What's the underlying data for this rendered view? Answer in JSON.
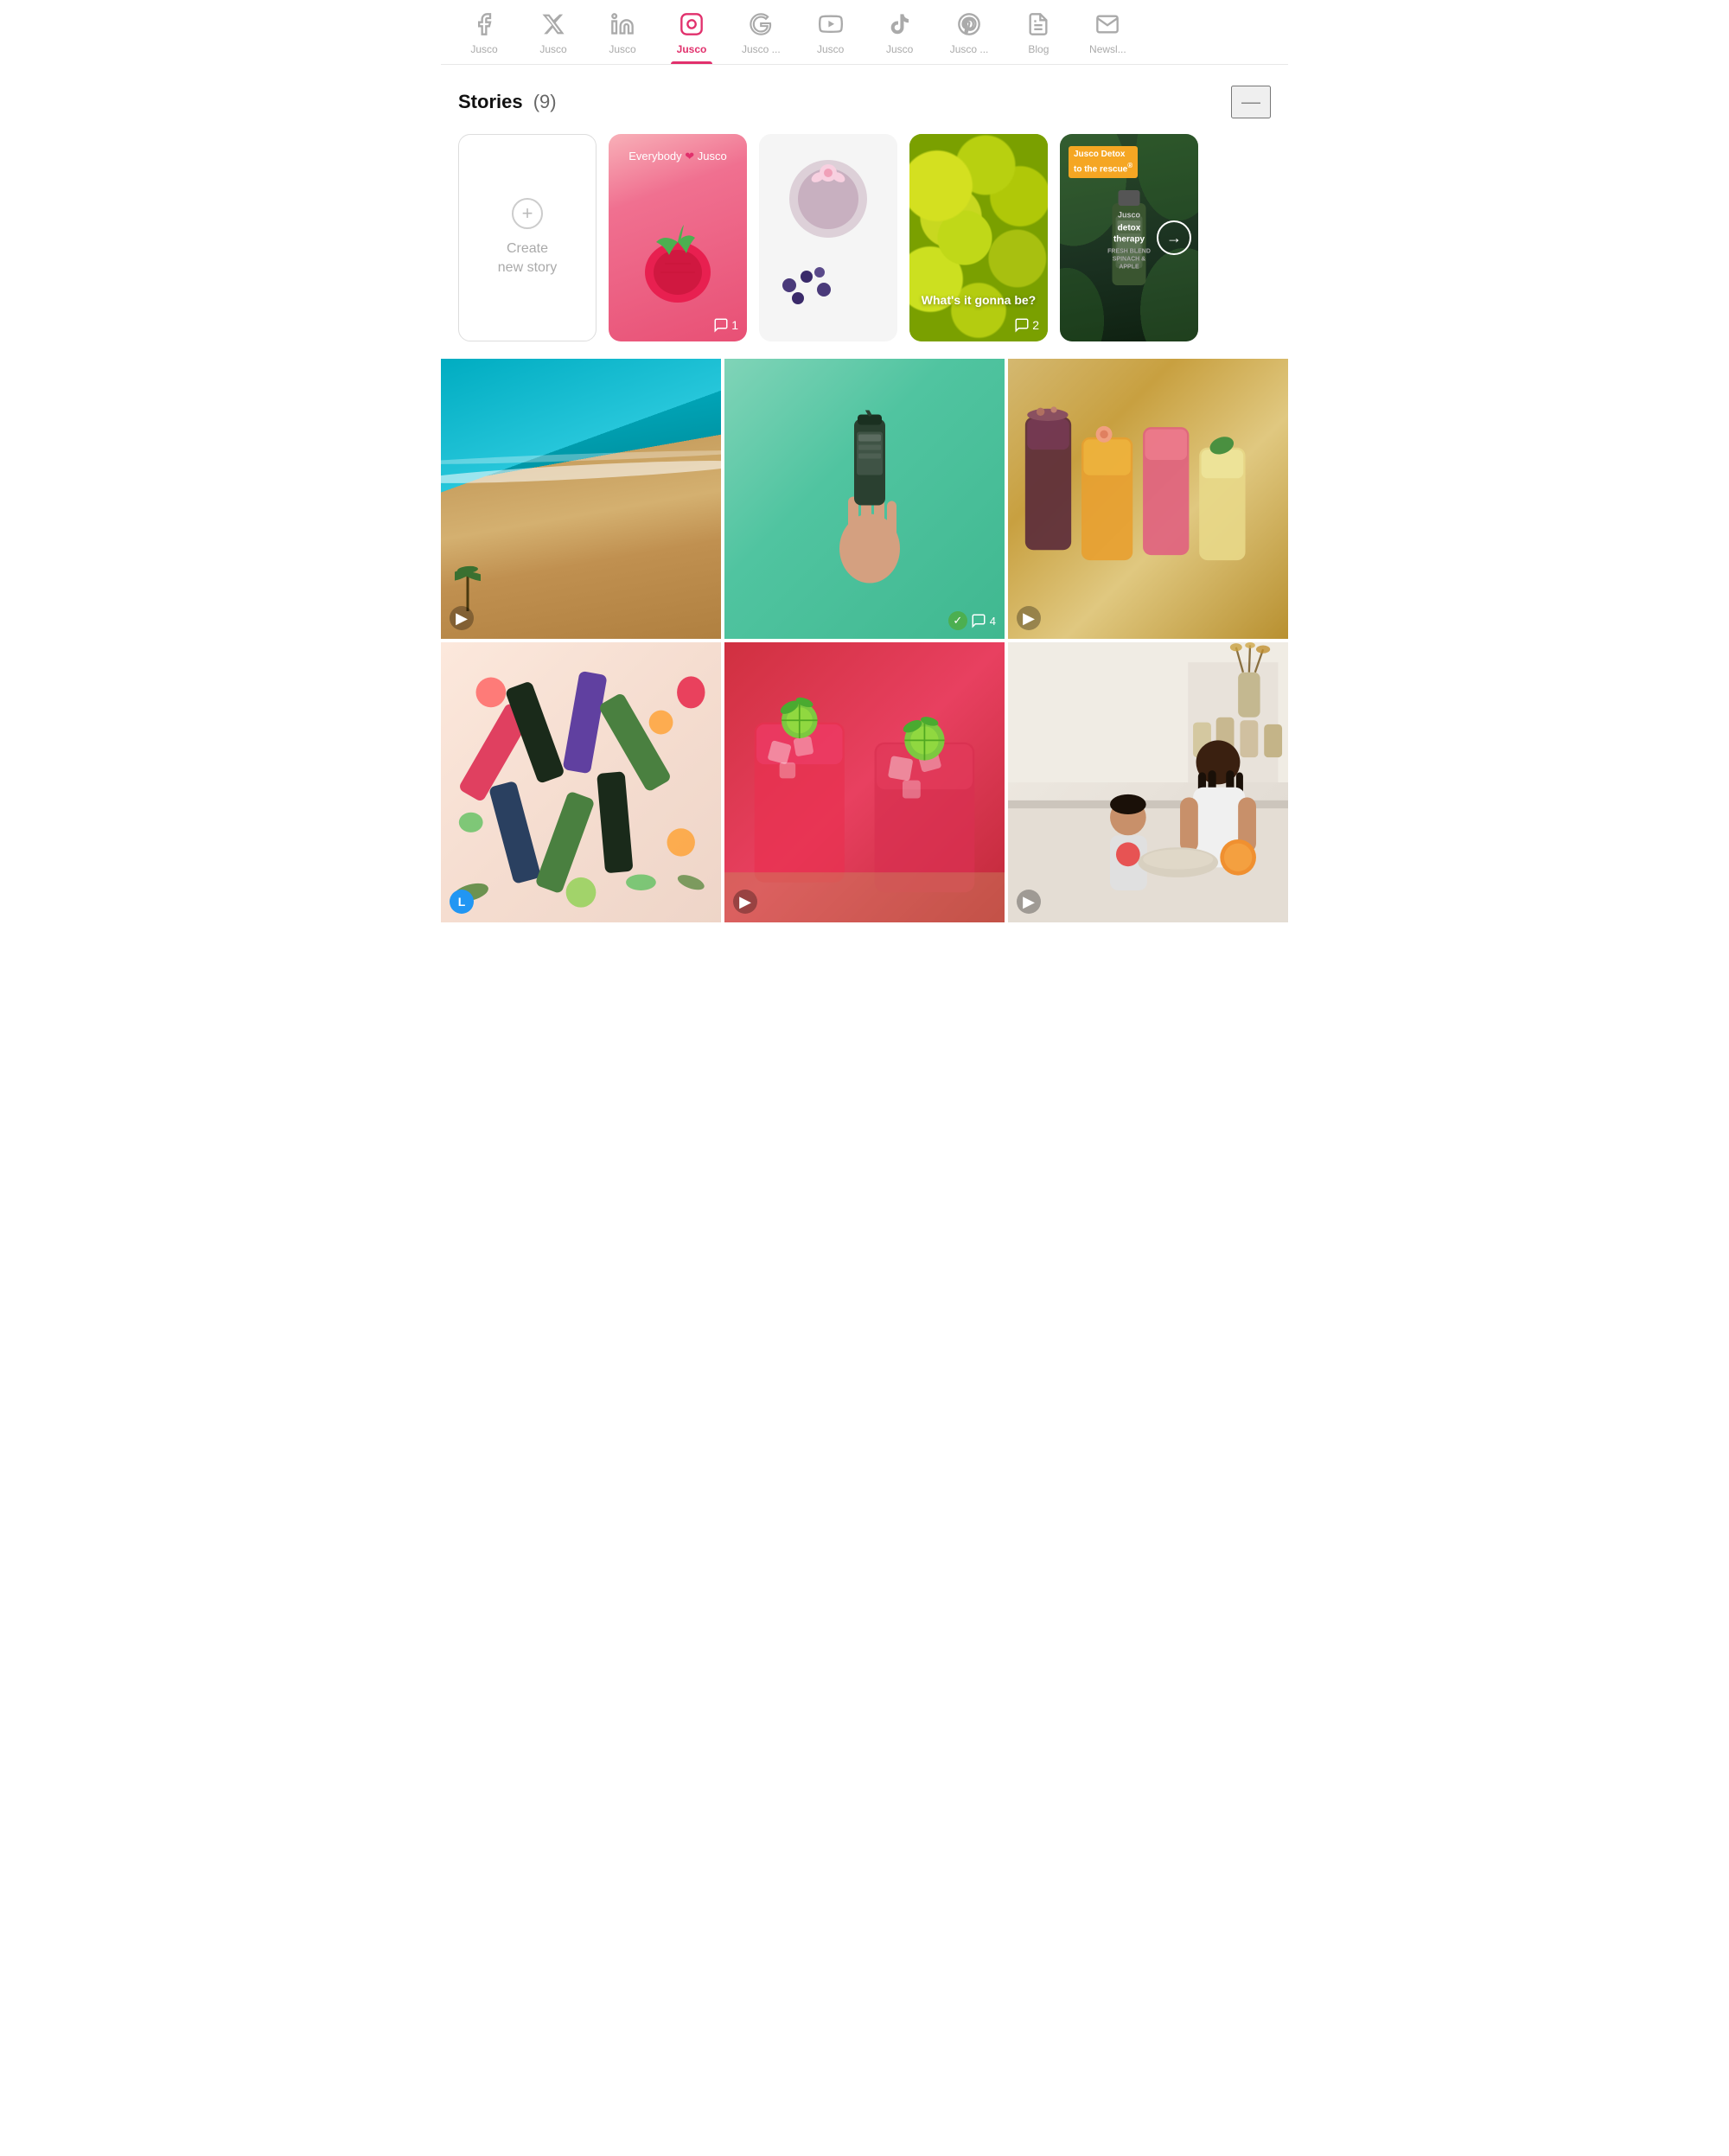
{
  "nav": {
    "items": [
      {
        "id": "facebook",
        "icon": "fb",
        "label": "Jusco",
        "active": false
      },
      {
        "id": "twitter",
        "icon": "tw",
        "label": "Jusco",
        "active": false
      },
      {
        "id": "linkedin",
        "icon": "li",
        "label": "Jusco",
        "active": false
      },
      {
        "id": "instagram",
        "icon": "ig",
        "label": "Jusco",
        "active": true
      },
      {
        "id": "google",
        "icon": "g",
        "label": "Jusco ...",
        "active": false
      },
      {
        "id": "youtube",
        "icon": "yt",
        "label": "Jusco",
        "active": false
      },
      {
        "id": "tiktok",
        "icon": "tt",
        "label": "Jusco",
        "active": false
      },
      {
        "id": "pinterest",
        "icon": "pt",
        "label": "Jusco ...",
        "active": false
      },
      {
        "id": "blog",
        "icon": "bl",
        "label": "Blog",
        "active": false
      },
      {
        "id": "newsletter",
        "icon": "nl",
        "label": "Newsl...",
        "active": false
      }
    ]
  },
  "stories": {
    "title": "Stories",
    "count": "(9)",
    "create_label": "Create\nnew story",
    "cards": [
      {
        "id": "story-1",
        "type": "create"
      },
      {
        "id": "story-2",
        "type": "strawberry",
        "top_text": "Everybody ❤ Jusco",
        "comments": "1"
      },
      {
        "id": "story-3",
        "type": "smoothie_cup",
        "comments": ""
      },
      {
        "id": "story-4",
        "type": "lemon",
        "text": "What's it gonna be?",
        "comments": "2"
      },
      {
        "id": "story-5",
        "type": "detox",
        "tag_line1": "Jusco Detox",
        "tag_line2": "to the rescue",
        "brand": "Jusco",
        "product": "detox\ntherapy",
        "sub": "FRESH BLEND\nSPINACH & APPLE"
      }
    ]
  },
  "posts": {
    "grid": [
      {
        "id": "post-1",
        "type": "beach",
        "has_play": true,
        "badge": null
      },
      {
        "id": "post-2",
        "type": "bottle_hand",
        "has_play": false,
        "badge": {
          "check": true,
          "comments": "4"
        }
      },
      {
        "id": "post-3",
        "type": "smoothies",
        "has_play": true,
        "badge": null
      },
      {
        "id": "post-4",
        "type": "bottles",
        "has_play": false,
        "badge": {
          "user": "L"
        }
      },
      {
        "id": "post-5",
        "type": "red_drinks",
        "has_play": true,
        "badge": null
      },
      {
        "id": "post-6",
        "type": "kitchen",
        "has_play": true,
        "badge": null
      }
    ]
  },
  "colors": {
    "active_pink": "#e1306c",
    "green_check": "#4caf50",
    "blue_badge": "#2196f3",
    "orange_tag": "#f5a623"
  },
  "icons": {
    "plus": "+",
    "play": "▶",
    "arrow_right": "→",
    "check": "✓",
    "minus": "—"
  }
}
